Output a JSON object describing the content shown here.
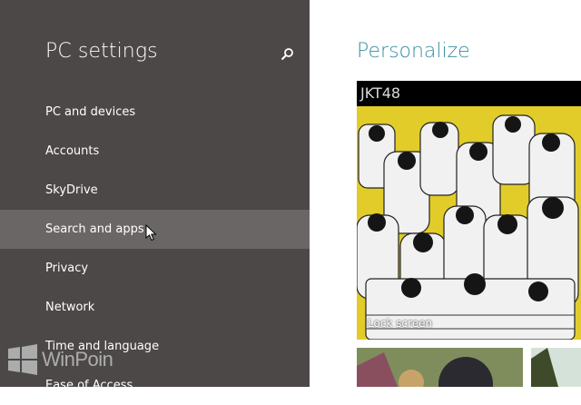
{
  "settings": {
    "title": "PC settings",
    "search_icon": "search-icon",
    "nav": [
      {
        "label": "PC and devices"
      },
      {
        "label": "Accounts"
      },
      {
        "label": "SkyDrive"
      },
      {
        "label": "Search and apps",
        "state": "hovered"
      },
      {
        "label": "Privacy"
      },
      {
        "label": "Network"
      },
      {
        "label": "Time and language"
      },
      {
        "label": "Ease of Access"
      }
    ]
  },
  "personalize": {
    "title": "Personalize",
    "lock_screen": {
      "header": "JKT48",
      "caption": "Lock screen"
    }
  },
  "watermark": {
    "text": "WinPoin"
  },
  "colors": {
    "pane_bg": "#4b4847",
    "hover_bg": "#6a6665",
    "accent": "#3a8ea0",
    "poster_yellow": "#e2cc2a"
  }
}
